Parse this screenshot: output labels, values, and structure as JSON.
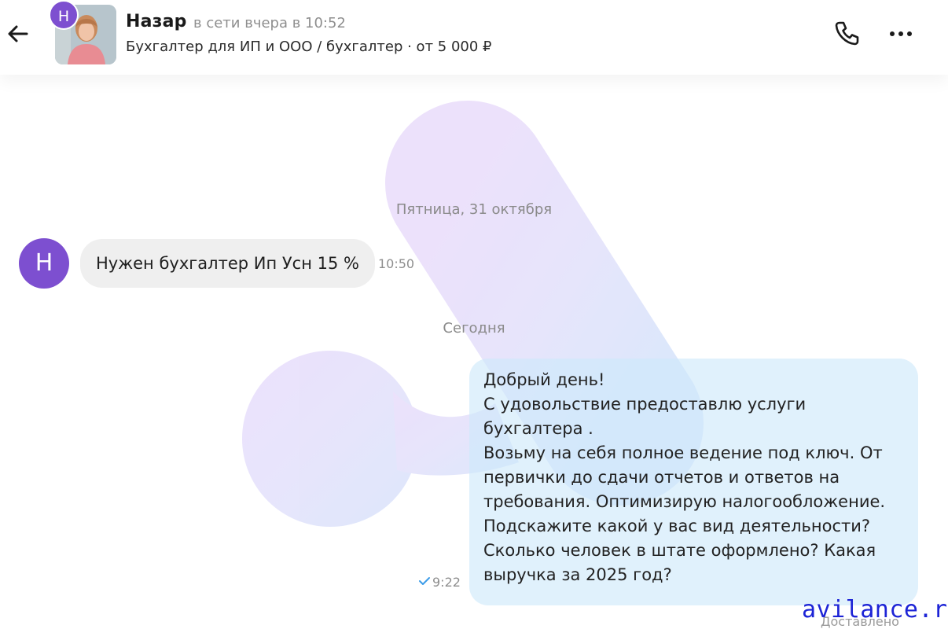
{
  "header": {
    "contact_name": "Назар",
    "contact_status": "в сети вчера в 10:52",
    "contact_subtitle": "Бухгалтер для ИП и ООО / бухгалтер · от 5 000 ₽",
    "avatar_badge_letter": "Н",
    "icons": {
      "back": "arrow-left-icon",
      "phone": "phone-icon",
      "more": "more-horizontal-icon"
    }
  },
  "chat": {
    "date_separator_1": "Пятница, 31 октября",
    "date_separator_2": "Сегодня",
    "incoming": {
      "avatar_letter": "Н",
      "text": "Нужен бухгалтер Ип Усн 15 %",
      "time": "10:50"
    },
    "outgoing": {
      "lines": [
        "Добрый день!",
        "С удовольствие предоставлю услуги",
        "бухгалтера .",
        "Возьму на себя полное ведение под ключ. От",
        "первички до сдачи отчетов и ответов на",
        "требования. Оптимизирую налогообложение.",
        "Подскажите какой у вас вид деятельности?",
        "Сколько человек в штате оформлено? Какая",
        "выручка за 2025 год?"
      ],
      "time": "9:22",
      "status_icon": "check-icon",
      "status_text": "Доставлено"
    }
  },
  "watermark": {
    "site": "avilance.ru"
  },
  "colors": {
    "accent_purple": "#7d4fd0",
    "incoming_bubble": "#efefef",
    "outgoing_bubble": "#cde8fa",
    "check": "#3b9ce8",
    "brand_blue": "#1d24d6"
  }
}
